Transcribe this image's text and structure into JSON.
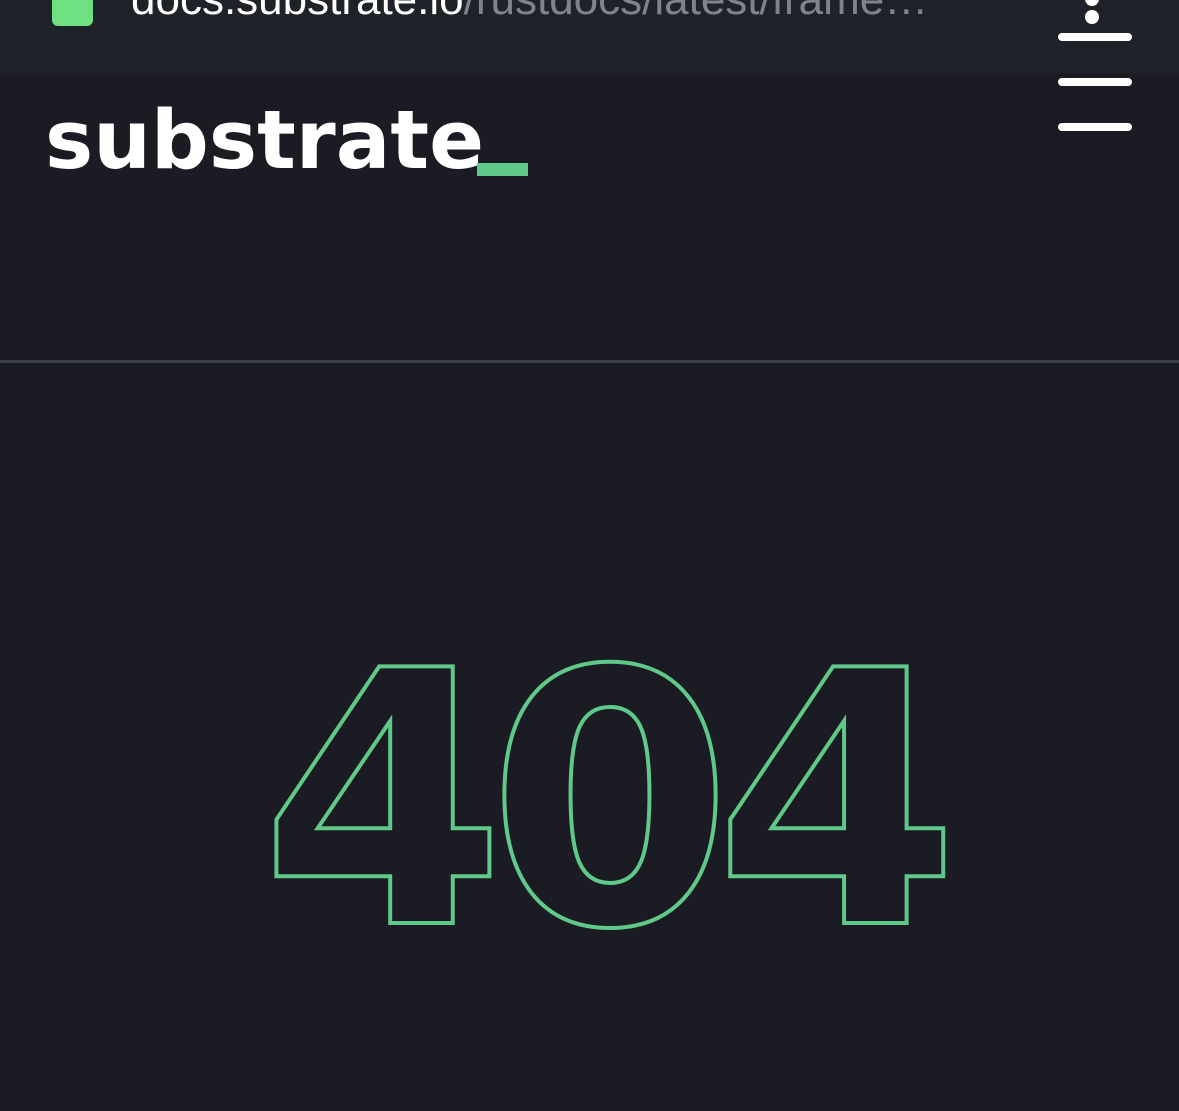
{
  "browser": {
    "url_domain": "docs.substrate.io",
    "url_path": "/rustdocs/latest/frame…",
    "favicon_color": "#6ee07f",
    "menu_icon": "kebab-menu-icon"
  },
  "header": {
    "logo_text": "substrate",
    "logo_accent_color": "#5fc98a",
    "menu_icon": "hamburger-menu-icon"
  },
  "error": {
    "code": "404",
    "outline_color": "#5fc98a"
  }
}
